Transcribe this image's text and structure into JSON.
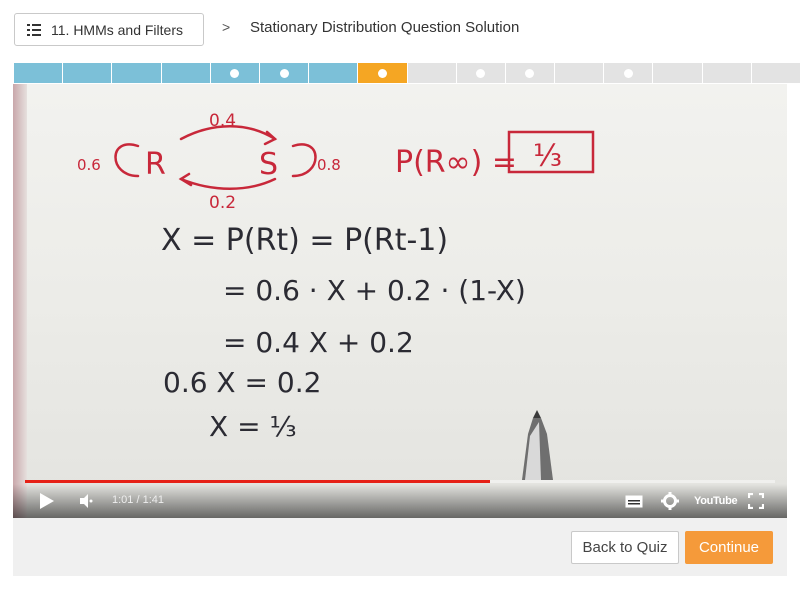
{
  "header": {
    "lesson_label": "11. HMMs and Filters",
    "breadcrumb_separator": ">",
    "page_title": "Stationary Distribution Question Solution"
  },
  "progress": {
    "segments": [
      {
        "state": "done",
        "dot": false
      },
      {
        "state": "done",
        "dot": false
      },
      {
        "state": "done",
        "dot": false
      },
      {
        "state": "done",
        "dot": false
      },
      {
        "state": "done",
        "dot": true
      },
      {
        "state": "done",
        "dot": true
      },
      {
        "state": "done",
        "dot": false
      },
      {
        "state": "current",
        "dot": true
      },
      {
        "state": "todo",
        "dot": false
      },
      {
        "state": "todo",
        "dot": true
      },
      {
        "state": "todo",
        "dot": true
      },
      {
        "state": "todo",
        "dot": false
      },
      {
        "state": "todo",
        "dot": true
      },
      {
        "state": "todo",
        "dot": false
      },
      {
        "state": "todo",
        "dot": false
      },
      {
        "state": "todo",
        "dot": false
      }
    ],
    "colors": {
      "done": "#7cc0d8",
      "current": "#f5a623",
      "todo": "#e3e3e3"
    }
  },
  "video": {
    "time_display": "1:01 / 1:41",
    "played_fraction": 0.62,
    "youtube_label": "YouTube",
    "whiteboard": {
      "diagram": {
        "top_arrow": "0.4",
        "bottom_arrow": "0.2",
        "left_loop": "0.6",
        "right_loop": "0.8",
        "state_r": "R",
        "state_s": "S"
      },
      "result": "P(R∞) =",
      "result_value": "⅓",
      "lines": [
        "X = P(Rt) = P(Rt-1)",
        "= 0.6 · X + 0.2 · (1-X)",
        "= 0.4 X + 0.2",
        "0.6 X = 0.2",
        "X = ⅓"
      ]
    }
  },
  "footer": {
    "back_label": "Back to Quiz",
    "continue_label": "Continue"
  }
}
